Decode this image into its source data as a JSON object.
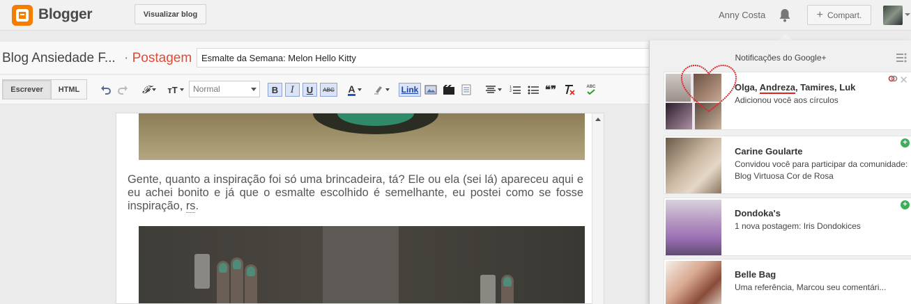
{
  "topbar": {
    "brand": "Blogger",
    "view_blog": "Visualizar blog",
    "user_name": "Anny Costa",
    "share": "Compart."
  },
  "post": {
    "blog_name": "Blog Ansiedade F...",
    "separator": "·",
    "section": "Postagem",
    "title_value": "Esmalte da Semana: Melon Hello Kitty",
    "body_text_1": "Gente, quanto a inspiração foi só uma brincadeira, tá? Ele ou ela (sei lá) apareceu aqui e eu achei bonito e já que o esmalte escolhido é semelhante, eu postei como se fosse inspiração, ",
    "body_text_rs": "rs",
    "body_text_end": "."
  },
  "toolbar": {
    "write": "Escrever",
    "html": "HTML",
    "font_size_icon": "тT",
    "font_value": "Normal",
    "bold": "B",
    "italic": "I",
    "underline": "U",
    "strike": "ABC",
    "text_color": "A",
    "link": "Link",
    "spell": "ABC",
    "quote": "❝❞",
    "font_icon": "𝓕",
    "colors": {
      "text_color_bar": "#2255cc",
      "accent_orange": "#f57d00",
      "postagem": "#dd4b39"
    }
  },
  "notifications": {
    "title": "Notificações do Google+",
    "items": [
      {
        "name_parts": [
          "Olga, ",
          "Andreza",
          ", Tamires, Luk"
        ],
        "body": "Adicionou você aos círculos"
      },
      {
        "name": "Carine Goularte",
        "body": "Convidou você para participar da comunidade: Blog Virtuosa Cor de Rosa"
      },
      {
        "name": "Dondoka's",
        "body": "1 nova postagem: Iris Dondokices"
      },
      {
        "name": "Belle Bag",
        "body": "Uma referência, Marcou seu comentári..."
      }
    ]
  }
}
